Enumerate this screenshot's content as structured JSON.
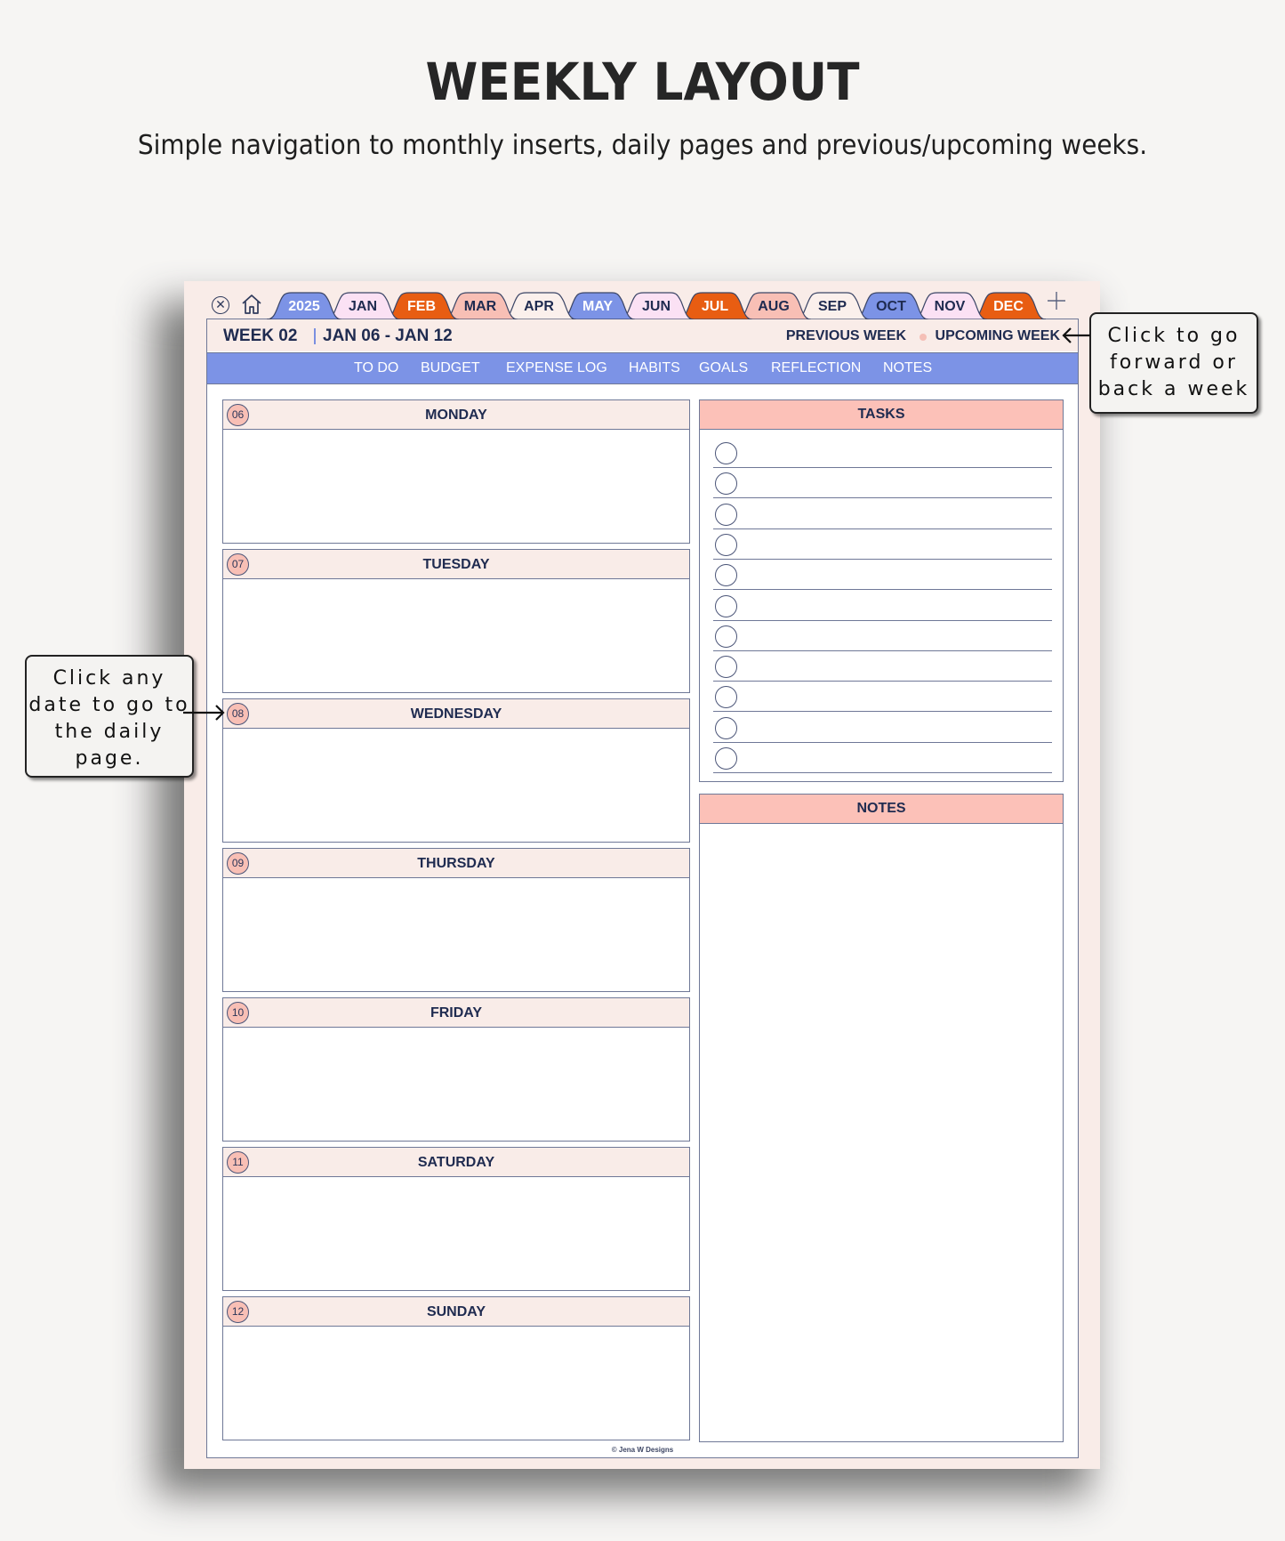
{
  "hero": {
    "title": "WEEKLY LAYOUT",
    "subtitle": "Simple navigation to monthly inserts, daily pages and previous/upcoming weeks."
  },
  "toolbar": {
    "close_icon": "close-circle-icon",
    "home_icon": "home-icon",
    "add_icon": "plus-icon"
  },
  "tabs": [
    {
      "label": "2025",
      "color": "#7c93e6",
      "text": "#ffffff"
    },
    {
      "label": "JAN",
      "color": "#fbe1f4",
      "text": "#1f2b50"
    },
    {
      "label": "FEB",
      "color": "#e85d12",
      "text": "#ffffff"
    },
    {
      "label": "MAR",
      "color": "#f8bfb5",
      "text": "#1f2b50"
    },
    {
      "label": "APR",
      "color": "#fbf0ec",
      "text": "#1f2b50"
    },
    {
      "label": "MAY",
      "color": "#7c93e6",
      "text": "#ffffff"
    },
    {
      "label": "JUN",
      "color": "#fbe1f4",
      "text": "#1f2b50"
    },
    {
      "label": "JUL",
      "color": "#e85d12",
      "text": "#ffffff"
    },
    {
      "label": "AUG",
      "color": "#f8bfb5",
      "text": "#1f2b50"
    },
    {
      "label": "SEP",
      "color": "#fbf0ec",
      "text": "#1f2b50"
    },
    {
      "label": "OCT",
      "color": "#7c93e6",
      "text": "#1f2b50"
    },
    {
      "label": "NOV",
      "color": "#fbe1f4",
      "text": "#1f2b50"
    },
    {
      "label": "DEC",
      "color": "#e85d12",
      "text": "#ffffff"
    }
  ],
  "header": {
    "week": "WEEK 02",
    "range": "JAN 06 - JAN 12",
    "previous": "PREVIOUS WEEK",
    "upcoming": "UPCOMING WEEK"
  },
  "nav": [
    "TO DO",
    "BUDGET",
    "EXPENSE LOG",
    "HABITS",
    "GOALS",
    "REFLECTION",
    "NOTES"
  ],
  "days": [
    {
      "num": "06",
      "name": "MONDAY"
    },
    {
      "num": "07",
      "name": "TUESDAY"
    },
    {
      "num": "08",
      "name": "WEDNESDAY"
    },
    {
      "num": "09",
      "name": "THURSDAY"
    },
    {
      "num": "10",
      "name": "FRIDAY"
    },
    {
      "num": "11",
      "name": "SATURDAY"
    },
    {
      "num": "12",
      "name": "SUNDAY"
    }
  ],
  "tasks": {
    "title": "TASKS",
    "count": 11
  },
  "notes": {
    "title": "NOTES"
  },
  "credit": "© Jena W Designs",
  "callouts": {
    "week_nav": "Click to go forward or back a week",
    "daily": "Click any date to go to the daily page."
  },
  "colors": {
    "navy": "#1f2b50",
    "periwinkle": "#7c93e6",
    "salmon": "#fcc1b8",
    "blush": "#f9ece8",
    "orange": "#e85d12"
  }
}
